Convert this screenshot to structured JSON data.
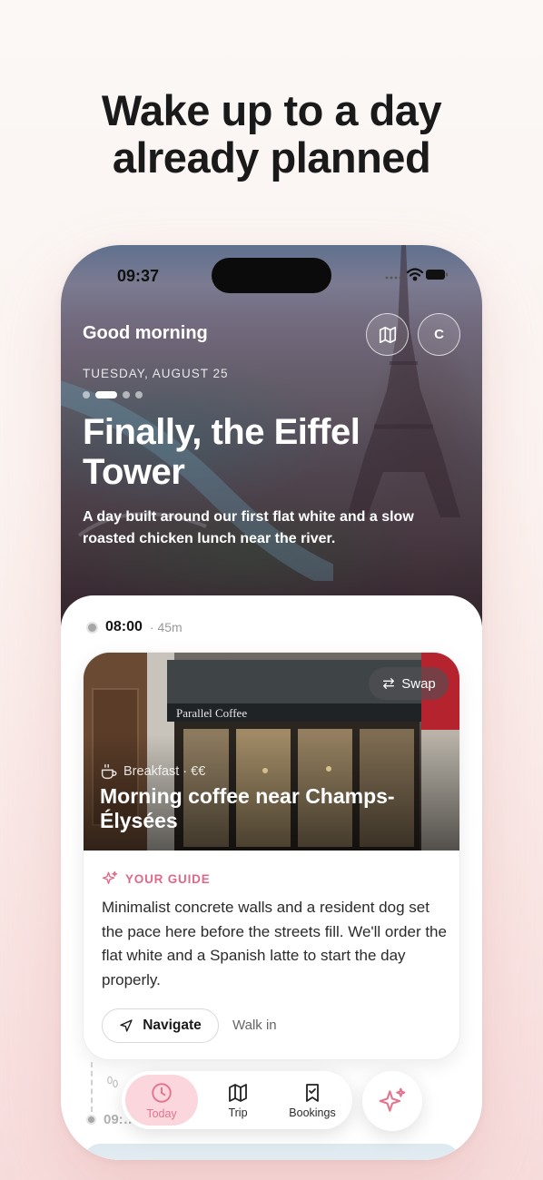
{
  "headline": {
    "line1": "Wake up to a day",
    "line2": "already planned"
  },
  "status_bar": {
    "time": "09:37"
  },
  "header": {
    "greeting": "Good morning",
    "avatar_initial": "C",
    "date": "TUESDAY, AUGUST 25",
    "carousel": {
      "count": 4,
      "active_index": 1
    }
  },
  "hero": {
    "title": "Finally, the Eiffel Tower",
    "subtitle": "A day built around our first flat white and a slow roasted chicken lunch near the river."
  },
  "itinerary": {
    "first_item": {
      "time": "08:00",
      "duration": "· 45m",
      "swap_label": "Swap",
      "category": "Breakfast · €€",
      "title": "Morning coffee near Champs-Élysées",
      "shop_sign": "Parallel Coffee",
      "guide_label": "YOUR GUIDE",
      "guide_text": "Minimalist concrete walls and a resident dog set the pace here before the streets fill. We'll order the flat white and a Spanish latte to start the day properly.",
      "navigate_label": "Navigate",
      "booking_note": "Walk in"
    },
    "next_item": {
      "time": "09:…"
    }
  },
  "tabbar": {
    "tabs": [
      {
        "label": "Today",
        "icon": "clock-icon",
        "active": true
      },
      {
        "label": "Trip",
        "icon": "map-icon",
        "active": false
      },
      {
        "label": "Bookings",
        "icon": "bookmark-icon",
        "active": false
      }
    ],
    "ai_button_icon": "sparkle-icon"
  },
  "colors": {
    "accent": "#e0698a",
    "active_tab_bg": "#fbd6dd",
    "text_dark": "#1a1a1a"
  }
}
